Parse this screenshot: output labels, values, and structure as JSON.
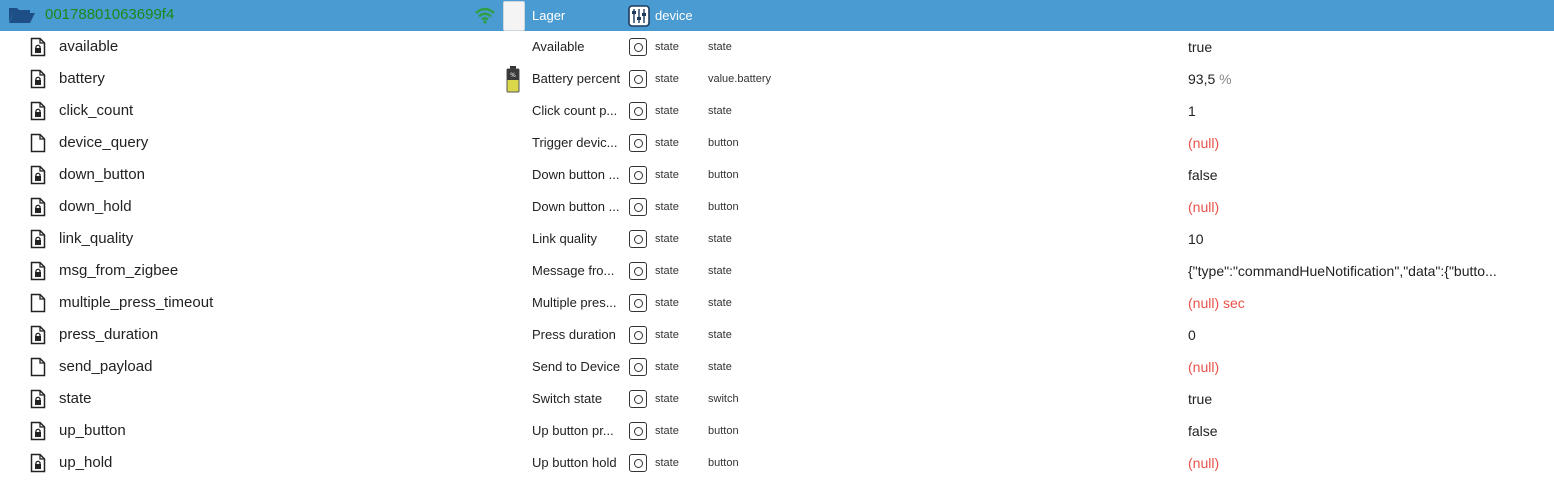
{
  "header": {
    "device_id": "00178801063699f4",
    "room": "Lager",
    "type": "device",
    "colors": {
      "bar": "#4a9bd2",
      "id_text": "#1a8a1a",
      "null_text": "#e8524a"
    }
  },
  "rows": [
    {
      "id": "available",
      "name": "Available",
      "type": "state",
      "role": "state",
      "value": "true",
      "unit": "",
      "is_null": false,
      "locked": true,
      "battery_icon": false
    },
    {
      "id": "battery",
      "name": "Battery percent",
      "type": "state",
      "role": "value.battery",
      "value": "93,5",
      "unit": " %",
      "is_null": false,
      "locked": true,
      "battery_icon": true
    },
    {
      "id": "click_count",
      "name": "Click count p...",
      "type": "state",
      "role": "state",
      "value": "1",
      "unit": "",
      "is_null": false,
      "locked": true,
      "battery_icon": false
    },
    {
      "id": "device_query",
      "name": "Trigger devic...",
      "type": "state",
      "role": "button",
      "value": "(null)",
      "unit": "",
      "is_null": true,
      "locked": false,
      "battery_icon": false
    },
    {
      "id": "down_button",
      "name": "Down button ...",
      "type": "state",
      "role": "button",
      "value": "false",
      "unit": "",
      "is_null": false,
      "locked": true,
      "battery_icon": false
    },
    {
      "id": "down_hold",
      "name": "Down button ...",
      "type": "state",
      "role": "button",
      "value": "(null)",
      "unit": "",
      "is_null": true,
      "locked": true,
      "battery_icon": false
    },
    {
      "id": "link_quality",
      "name": "Link quality",
      "type": "state",
      "role": "state",
      "value": "10",
      "unit": "",
      "is_null": false,
      "locked": true,
      "battery_icon": false
    },
    {
      "id": "msg_from_zigbee",
      "name": "Message fro...",
      "type": "state",
      "role": "state",
      "value": "{\"type\":\"commandHueNotification\",\"data\":{\"butto...",
      "unit": "",
      "is_null": false,
      "locked": true,
      "battery_icon": false
    },
    {
      "id": "multiple_press_timeout",
      "name": "Multiple pres...",
      "type": "state",
      "role": "state",
      "value": "(null)",
      "unit": " sec",
      "is_null": true,
      "locked": false,
      "battery_icon": false
    },
    {
      "id": "press_duration",
      "name": "Press duration",
      "type": "state",
      "role": "state",
      "value": "0",
      "unit": "",
      "is_null": false,
      "locked": true,
      "battery_icon": false
    },
    {
      "id": "send_payload",
      "name": "Send to Device",
      "type": "state",
      "role": "state",
      "value": "(null)",
      "unit": "",
      "is_null": true,
      "locked": false,
      "battery_icon": false
    },
    {
      "id": "state",
      "name": "Switch state",
      "type": "state",
      "role": "switch",
      "value": "true",
      "unit": "",
      "is_null": false,
      "locked": true,
      "battery_icon": false
    },
    {
      "id": "up_button",
      "name": "Up button pr...",
      "type": "state",
      "role": "button",
      "value": "false",
      "unit": "",
      "is_null": false,
      "locked": true,
      "battery_icon": false
    },
    {
      "id": "up_hold",
      "name": "Up button hold",
      "type": "state",
      "role": "button",
      "value": "(null)",
      "unit": "",
      "is_null": true,
      "locked": true,
      "battery_icon": false
    }
  ]
}
